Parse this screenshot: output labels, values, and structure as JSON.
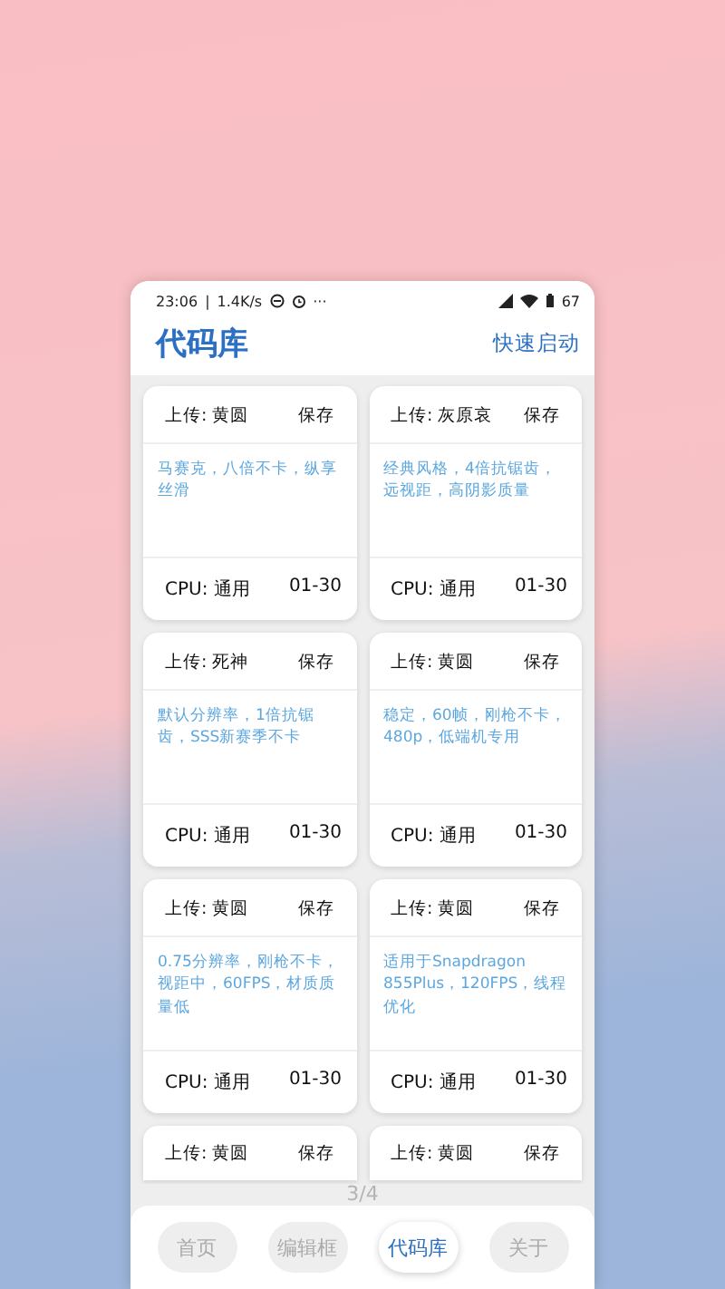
{
  "status_bar": {
    "time": "23:06",
    "separator": "|",
    "speed": "1.4K/s",
    "more": "···",
    "battery": "67"
  },
  "header": {
    "title": "代码库",
    "action": "快速启动"
  },
  "columns": [
    {
      "cards": [
        {
          "uploader": "上传: 黄圆",
          "save": "保存",
          "description": "马赛克，八倍不卡，纵享丝滑",
          "cpu": "CPU: 通用",
          "date": "01-30"
        },
        {
          "uploader": "上传: 死神",
          "save": "保存",
          "description": "默认分辨率，1倍抗锯齿，SSS新赛季不卡",
          "cpu": "CPU: 通用",
          "date": "01-30"
        },
        {
          "uploader": "上传: 黄圆",
          "save": "保存",
          "description": "0.75分辨率，刚枪不卡，视距中，60FPS，材质质量低",
          "cpu": "CPU: 通用",
          "date": "01-30"
        },
        {
          "uploader": "上传: 黄圆",
          "save": "保存"
        }
      ]
    },
    {
      "cards": [
        {
          "uploader": "上传: 灰原哀",
          "save": "保存",
          "description": "经典风格，4倍抗锯齿，远视距，高阴影质量",
          "cpu": "CPU: 通用",
          "date": "01-30"
        },
        {
          "uploader": "上传: 黄圆",
          "save": "保存",
          "description": "稳定，60帧，刚枪不卡，480p，低端机专用",
          "cpu": "CPU: 通用",
          "date": "01-30"
        },
        {
          "uploader": "上传: 黄圆",
          "save": "保存",
          "description": "适用于Snapdragon 855Plus，120FPS，线程优化",
          "cpu": "CPU: 通用",
          "date": "01-30"
        },
        {
          "uploader": "上传: 黄圆",
          "save": "保存"
        }
      ]
    }
  ],
  "page_indicator": "3/4",
  "nav": [
    {
      "label": "首页",
      "selected": false
    },
    {
      "label": "编辑框",
      "selected": false
    },
    {
      "label": "代码库",
      "selected": true
    },
    {
      "label": "关于",
      "selected": false
    }
  ]
}
